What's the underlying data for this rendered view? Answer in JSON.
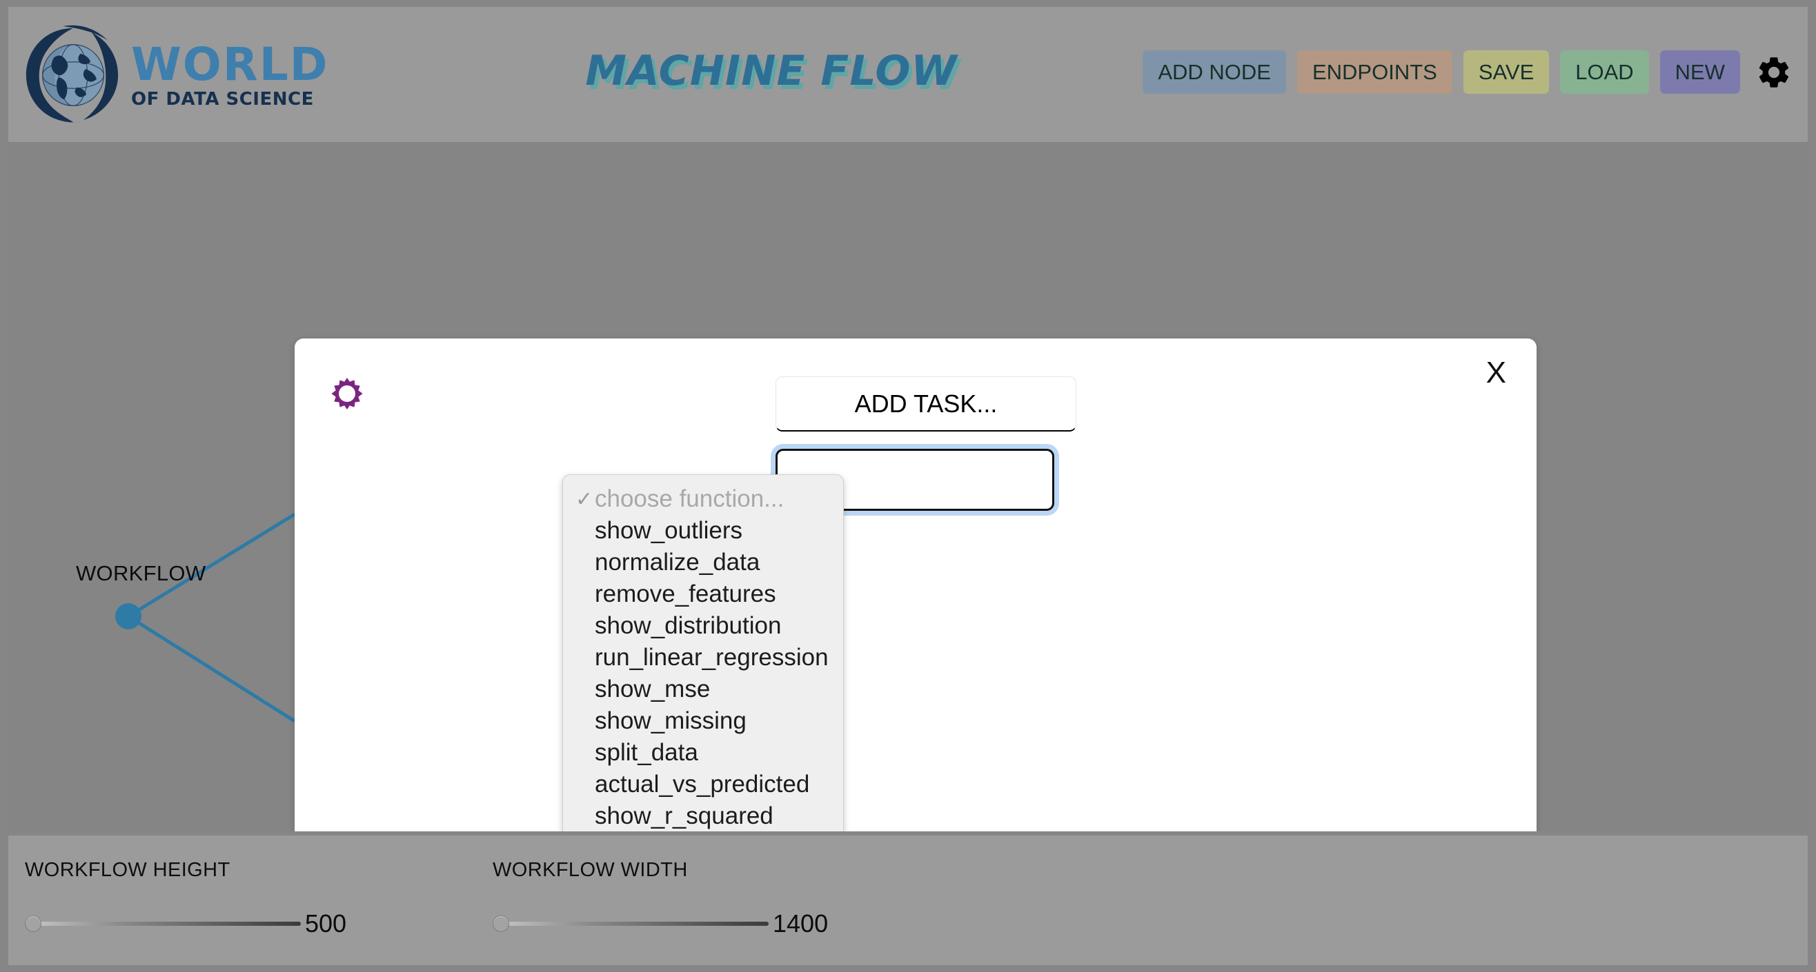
{
  "header": {
    "logo": {
      "icon": "globe-swoosh-logo",
      "primary_text": "WORLD",
      "secondary_text": "OF DATA SCIENCE",
      "primary_color": "#3e7fae",
      "secondary_color": "#16304f"
    },
    "app_title": "MACHINE FLOW",
    "app_title_color": "#2e6f96",
    "app_title_shadow_color": "#5fa6a5",
    "buttons": [
      {
        "label": "ADD NODE",
        "color": "#7f94a8",
        "name": "add-node-button"
      },
      {
        "label": "ENDPOINTS",
        "color": "#b49883",
        "name": "endpoints-button"
      },
      {
        "label": "SAVE",
        "color": "#b5b77f",
        "name": "save-button"
      },
      {
        "label": "LOAD",
        "color": "#87b392",
        "name": "load-button"
      },
      {
        "label": "NEW",
        "color": "#7d7bae",
        "name": "new-button"
      }
    ],
    "settings_icon": "gear-icon"
  },
  "canvas": {
    "background_color": "#858585",
    "node_label": "WORKFLOW",
    "node_color": "#2e7ba6",
    "edge_color": "#2e7ba6"
  },
  "modal": {
    "gear_icon": "gear-icon",
    "gear_color": "#7b2481",
    "close_label": "X",
    "task_input": {
      "value": "ADD TASK...",
      "placeholder": "ADD TASK..."
    },
    "select": {
      "selected": "choose function...",
      "checkmark": "✓",
      "options": [
        "choose function...",
        "show_outliers",
        "normalize_data",
        "remove_features",
        "show_distribution",
        "run_linear_regression",
        "show_mse",
        "show_missing",
        "split_data",
        "actual_vs_predicted",
        "show_r_squared"
      ]
    }
  },
  "bottom": {
    "sliders": [
      {
        "label": "WORKFLOW HEIGHT",
        "value": "500",
        "position_pct": 0
      },
      {
        "label": "WORKFLOW WIDTH",
        "value": "1400",
        "position_pct": 0
      }
    ]
  }
}
